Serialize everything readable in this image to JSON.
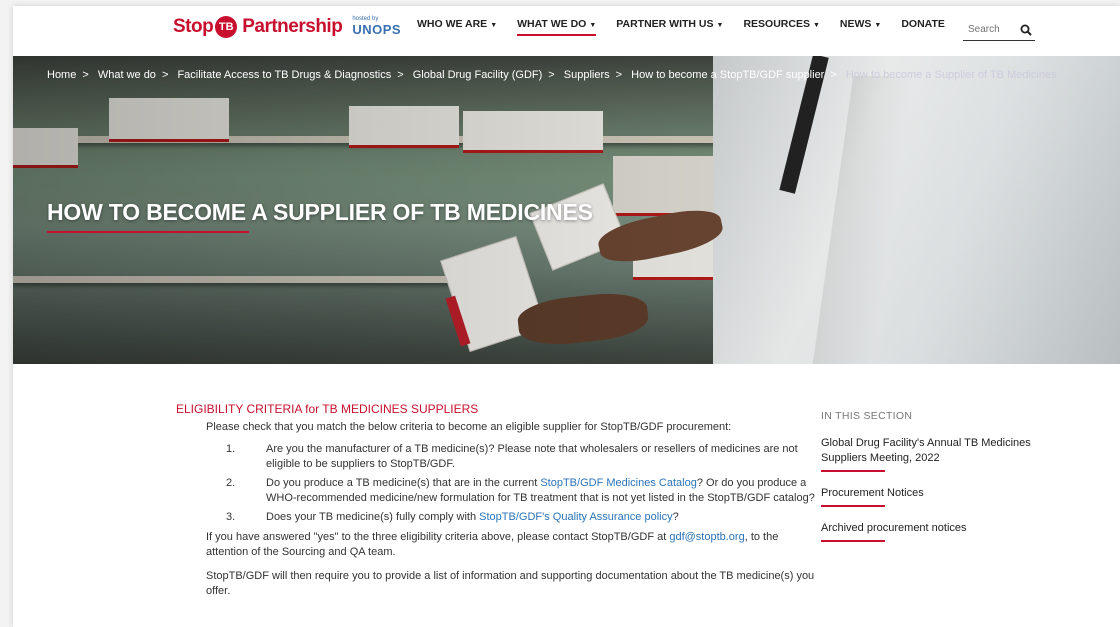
{
  "logo": {
    "stop": "Stop",
    "tb": "TB",
    "partnership": "Partnership",
    "hosted_by": "hosted by",
    "unops": "UNOPS"
  },
  "nav": {
    "items": [
      {
        "label": "WHO WE ARE",
        "dropdown": true
      },
      {
        "label": "WHAT WE DO",
        "dropdown": true,
        "active": true
      },
      {
        "label": "PARTNER WITH US",
        "dropdown": true
      },
      {
        "label": "RESOURCES",
        "dropdown": true
      },
      {
        "label": "NEWS",
        "dropdown": true
      },
      {
        "label": "DONATE",
        "dropdown": false
      }
    ],
    "search_placeholder": "Search",
    "search_icon": "search-icon"
  },
  "breadcrumb": {
    "items": [
      "Home",
      "What we do",
      "Facilitate Access to TB Drugs & Diagnostics",
      "Global Drug Facility (GDF)",
      "Suppliers",
      "How to become a StopTB/GDF supplier"
    ],
    "current": "How to become a Supplier of TB Medicines",
    "separator": ">"
  },
  "hero": {
    "title": "HOW TO BECOME A SUPPLIER OF TB MEDICINES"
  },
  "main": {
    "heading": "ELIGIBILITY CRITERIA for TB MEDICINES SUPPLIERS",
    "intro": "Please check that you match the below criteria to become an eligible supplier for StopTB/GDF procurement:",
    "criteria": [
      {
        "num": "1.",
        "pre": "Are you the manufacturer of a TB medicine(s)? Please note that wholesalers or resellers of medicines are not eligible to be suppliers to StopTB/GDF.",
        "link": "",
        "post": ""
      },
      {
        "num": "2.",
        "pre": "Do you produce a TB medicine(s) that are in the current ",
        "link": "StopTB/GDF Medicines Catalog",
        "post": "? Or do you produce a WHO-recommended medicine/new formulation for TB treatment that is not yet listed in the StopTB/GDF catalog?"
      },
      {
        "num": "3.",
        "pre": "Does your TB medicine(s) fully comply with ",
        "link": "StopTB/GDF's Quality Assurance policy",
        "post": "?"
      }
    ],
    "contact_pre": "If you have answered \"yes\" to the three eligibility criteria above, please contact StopTB/GDF at ",
    "contact_email": "gdf@stoptb.org",
    "contact_post": ", to the attention of the Sourcing and QA team.",
    "followup": "StopTB/GDF will then require you to provide a list of information and supporting documentation about the TB medicine(s) you offer."
  },
  "sidebar": {
    "title": "IN THIS SECTION",
    "links": [
      "Global Drug Facility's Annual TB Medicines Suppliers Meeting, 2022",
      "Procurement Notices",
      "Archived procurement notices"
    ]
  },
  "colors": {
    "accent": "#c8102e",
    "link": "#2a73b8",
    "brand_blue": "#3a6fb0"
  }
}
